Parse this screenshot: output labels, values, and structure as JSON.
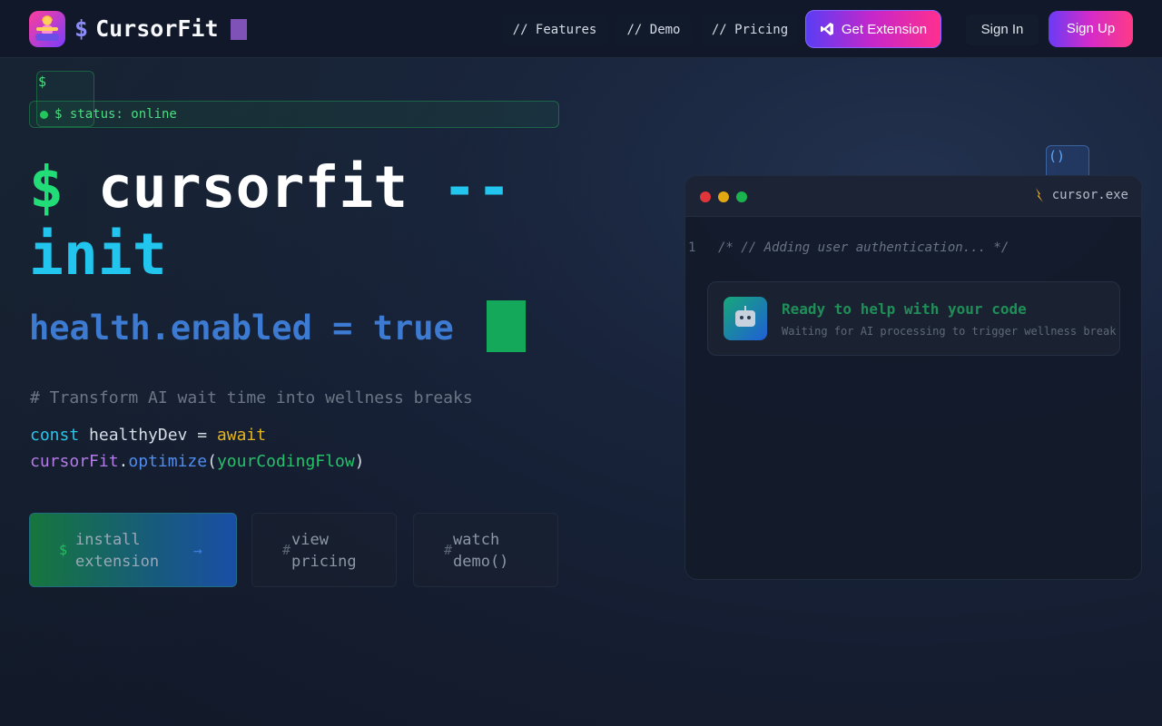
{
  "nav": {
    "brand_symbol": "$",
    "brand_name": "CursorFit",
    "links": [
      "// Features",
      "// Demo",
      "// Pricing"
    ],
    "get_extension": "Get Extension",
    "sign_in": "Sign In",
    "sign_up": "Sign Up"
  },
  "hero": {
    "float_symbol": "$",
    "status": "$ status: online",
    "title_dollar": "$",
    "title_main": "cursorfit",
    "title_flag_a": "--",
    "title_flag_b": "init",
    "subtitle": "health.enabled = true",
    "comment": "# Transform AI wait time into wellness breaks",
    "code": {
      "const_kw": "const",
      "var_name": " healthyDev = ",
      "await_kw": "await",
      "obj": "cursorFit",
      "dot": ".",
      "fn": "optimize",
      "open": "(",
      "arg": "yourCodingFlow",
      "close": ")"
    },
    "buttons": {
      "install": {
        "prefix": "$",
        "label": "install extension",
        "arrow": "→"
      },
      "pricing": {
        "prefix": "#",
        "label": "view pricing"
      },
      "demo": {
        "prefix": "#",
        "label": "watch demo()"
      }
    }
  },
  "editor": {
    "float_parens": "()",
    "file_name": "cursor.exe",
    "line_number": "1",
    "code_comment": "/* // Adding user authentication... */",
    "ai_title": "Ready to help with your code",
    "ai_subtitle": "Waiting for AI processing to trigger wellness break"
  },
  "colors": {
    "accent_green": "#22dd77",
    "accent_cyan": "#22c5ee",
    "accent_purple": "#6a3bf5",
    "accent_pink": "#ff3a86"
  },
  "icons": [
    "meditation-logo-icon",
    "vscode-icon",
    "lightning-icon",
    "robot-icon"
  ]
}
